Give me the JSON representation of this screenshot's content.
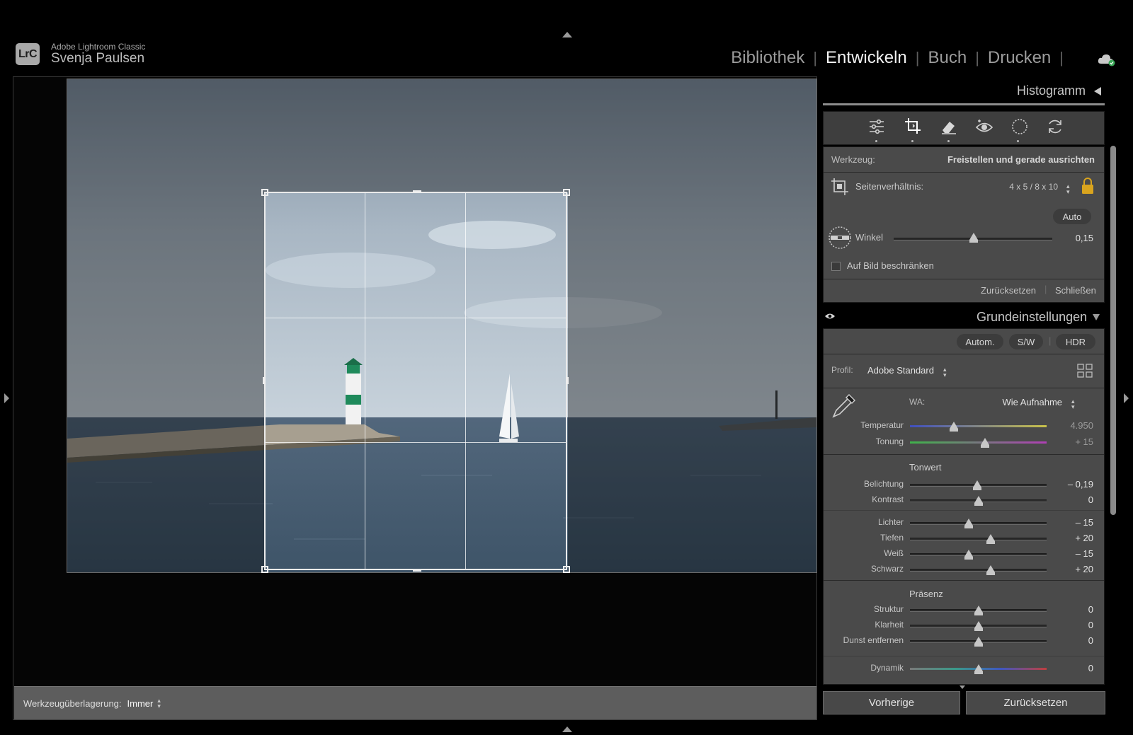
{
  "app": {
    "logo": "LrC",
    "product": "Adobe Lightroom Classic",
    "user": "Svenja Paulsen"
  },
  "modules": [
    {
      "label": "Bibliothek",
      "active": false
    },
    {
      "label": "Entwickeln",
      "active": true
    },
    {
      "label": "Buch",
      "active": false
    },
    {
      "label": "Drucken",
      "active": false
    }
  ],
  "toolbar": {
    "overlay_label": "Werkzeugüberlagerung:",
    "overlay_value": "Immer"
  },
  "panel": {
    "histogram_title": "Histogramm",
    "tools": [
      "sliders-icon",
      "crop-icon",
      "eraser-icon",
      "red-eye-icon",
      "mask-icon",
      "reset-icon"
    ],
    "crop": {
      "tool_label": "Werkzeug:",
      "tool_value": "Freistellen und gerade ausrichten",
      "aspect_label": "Seitenverhältnis:",
      "aspect_value": "4 x 5 / 8 x 10",
      "auto_label": "Auto",
      "angle_label": "Winkel",
      "angle_value": "0,15",
      "constrain_label": "Auf Bild beschränken",
      "reset_label": "Zurücksetzen",
      "close_label": "Schließen"
    },
    "basic": {
      "title": "Grundeinstellungen",
      "auto": "Autom.",
      "bw": "S/W",
      "hdr": "HDR",
      "profile_label": "Profil:",
      "profile_value": "Adobe Standard",
      "wb_label": "WA:",
      "wb_value": "Wie Aufnahme",
      "temp_label": "Temperatur",
      "temp_value": "4.950",
      "tint_label": "Tonung",
      "tint_value": "+ 15",
      "tone_heading": "Tonwert",
      "exposure_label": "Belichtung",
      "exposure_value": "– 0,19",
      "contrast_label": "Kontrast",
      "contrast_value": "0",
      "highlights_label": "Lichter",
      "highlights_value": "– 15",
      "shadows_label": "Tiefen",
      "shadows_value": "+ 20",
      "whites_label": "Weiß",
      "whites_value": "– 15",
      "blacks_label": "Schwarz",
      "blacks_value": "+ 20",
      "presence_heading": "Präsenz",
      "texture_label": "Struktur",
      "texture_value": "0",
      "clarity_label": "Klarheit",
      "clarity_value": "0",
      "dehaze_label": "Dunst entfernen",
      "dehaze_value": "0",
      "vibrance_label": "Dynamik",
      "vibrance_value": "0"
    },
    "prev_button": "Vorherige",
    "reset_button": "Zurücksetzen"
  }
}
